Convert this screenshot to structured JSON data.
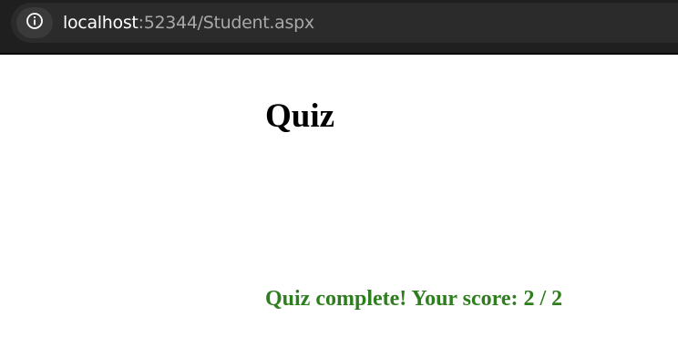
{
  "browser": {
    "url_host": "localhost",
    "url_rest": ":52344/Student.aspx",
    "info_icon": "info-circle-icon"
  },
  "page": {
    "title": "Quiz",
    "result_message": "Quiz complete! Your score: 2 / 2"
  },
  "colors": {
    "result_text": "#2e7d1e",
    "toolbar_background": "#1f1f1f"
  }
}
